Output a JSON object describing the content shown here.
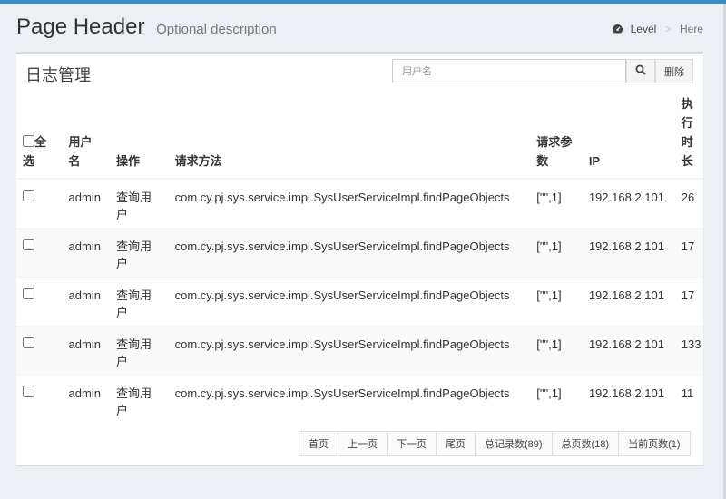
{
  "header": {
    "title": "Page Header",
    "description": "Optional description",
    "breadcrumb": [
      "Level",
      "Here"
    ]
  },
  "box": {
    "title": "日志管理",
    "search": {
      "placeholder": "用户名",
      "value": ""
    },
    "delete_label": "删除"
  },
  "table": {
    "headers": [
      "全选",
      "用户名",
      "操作",
      "请求方法",
      "请求参数",
      "IP",
      "执行时长"
    ],
    "rows": [
      {
        "user": "admin",
        "operation": "查询用户",
        "method": "com.cy.pj.sys.service.impl.SysUserServiceImpl.findPageObjects",
        "params": "[\"\",1]",
        "ip": "192.168.2.101",
        "time": "26"
      },
      {
        "user": "admin",
        "operation": "查询用户",
        "method": "com.cy.pj.sys.service.impl.SysUserServiceImpl.findPageObjects",
        "params": "[\"\",1]",
        "ip": "192.168.2.101",
        "time": "17"
      },
      {
        "user": "admin",
        "operation": "查询用户",
        "method": "com.cy.pj.sys.service.impl.SysUserServiceImpl.findPageObjects",
        "params": "[\"\",1]",
        "ip": "192.168.2.101",
        "time": "17"
      },
      {
        "user": "admin",
        "operation": "查询用户",
        "method": "com.cy.pj.sys.service.impl.SysUserServiceImpl.findPageObjects",
        "params": "[\"\",1]",
        "ip": "192.168.2.101",
        "time": "133"
      },
      {
        "user": "admin",
        "operation": "查询用户",
        "method": "com.cy.pj.sys.service.impl.SysUserServiceImpl.findPageObjects",
        "params": "[\"\",1]",
        "ip": "192.168.2.101",
        "time": "11"
      }
    ]
  },
  "pagination": {
    "first": "首页",
    "prev": "上一页",
    "next": "下一页",
    "last": "尾页",
    "total_records": "总记录数(89)",
    "total_pages": "总页数(18)",
    "current_page": "当前页数(1)"
  },
  "colors": {
    "accent": "#3c8dbc",
    "background": "#ecf0f5",
    "box_border": "#d2d6de"
  },
  "icons": {
    "breadcrumb": "dashboard-icon",
    "search": "search-icon"
  }
}
